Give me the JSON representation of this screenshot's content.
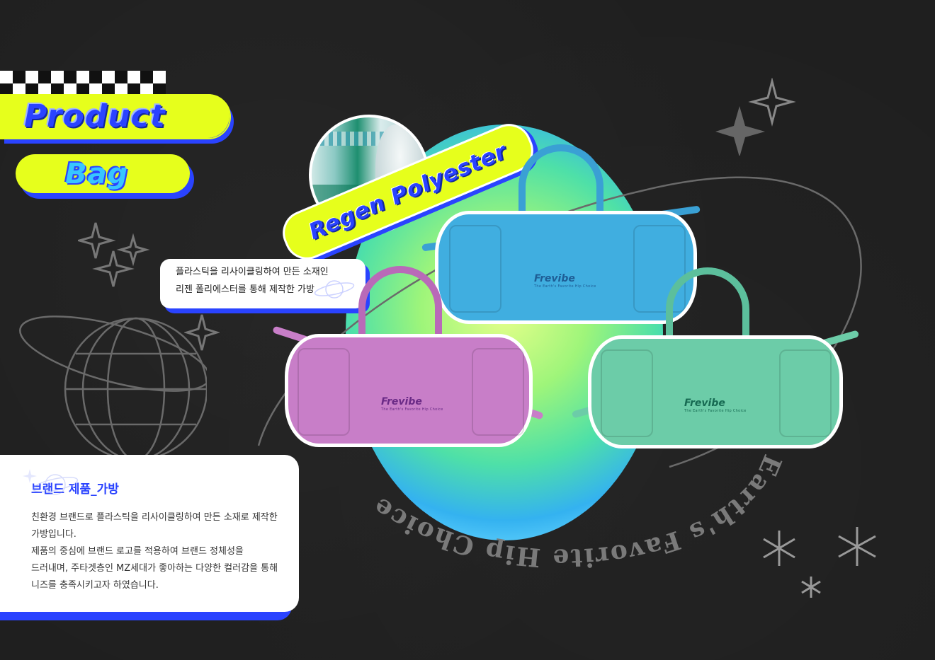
{
  "header": {
    "product_label": "Product",
    "bag_label": "Bag"
  },
  "material_badge": "Regen Polyester",
  "material_note": {
    "line1": "플라스틱을 리사이클링하여 만든 소재인",
    "line2": "리젠 폴리에스터를 통해 제작한 가방"
  },
  "bags": [
    {
      "color": "#40aee0",
      "logo": "Frevibe",
      "tagline": "The Earth's Favorite Hip Choice"
    },
    {
      "color": "#c87ec8",
      "logo": "Frevibe",
      "tagline": "The Earth's Favorite Hip Choice"
    },
    {
      "color": "#6ccca8",
      "logo": "Frevibe",
      "tagline": "The Earth's Favorite Hip Choice"
    }
  ],
  "arc_slogan": "Earth's Favorite Hip Choice",
  "description": {
    "title": "브랜드 제품_가방",
    "line1": "친환경 브랜드로 플라스틱을 리사이클링하여 만든 소재로 제작한",
    "line2": "가방입니다.",
    "line3": "제품의 중심에 브랜드 로고를 적용하여 브랜드 정체성을",
    "line4": "드러내며, 주타겟층인 MZ세대가 좋아하는 다양한 컬러감을 통해",
    "line5": "니즈를 충족시키고자 하였습니다."
  },
  "colors": {
    "accent_yellow": "#e6ff1c",
    "accent_blue": "#2a43ff",
    "background": "#1f1f1f"
  },
  "icons": [
    "checker-strip-icon",
    "sparkle-icon",
    "globe-wireframe-icon",
    "planet-icon",
    "asterisk-icon"
  ]
}
